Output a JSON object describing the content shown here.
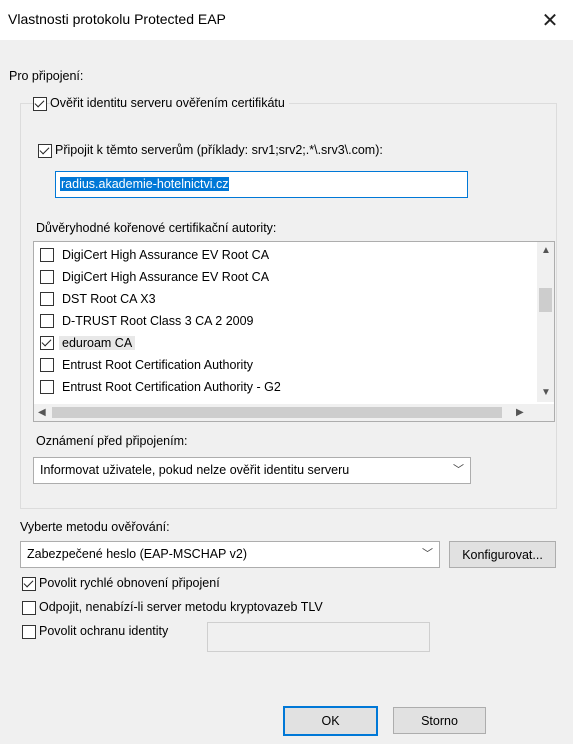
{
  "window": {
    "title": "Vlastnosti protokolu Protected EAP",
    "close_glyph": "✕"
  },
  "connection": {
    "label": "Pro připojení:",
    "verify_server_label": "Ověřit identitu serveru ověřením certifikátu",
    "verify_server_checked": true,
    "connect_servers_label": "Připojit k těmto serverům (příklady: srv1;srv2;.*\\.srv3\\.com):",
    "connect_servers_checked": true,
    "server_value": "radius.akademie-hotelnictvi.cz",
    "trusted_ca_label": "Důvěryhodné kořenové certifikační autority:",
    "ca_list": [
      {
        "name": "DigiCert High Assurance EV Root CA",
        "checked": false
      },
      {
        "name": "DigiCert High Assurance EV Root CA",
        "checked": false
      },
      {
        "name": "DST Root CA X3",
        "checked": false
      },
      {
        "name": "D-TRUST Root Class 3 CA 2 2009",
        "checked": false
      },
      {
        "name": "eduroam CA",
        "checked": true
      },
      {
        "name": "Entrust Root Certification Authority",
        "checked": false
      },
      {
        "name": "Entrust Root Certification Authority - G2",
        "checked": false
      }
    ],
    "notification_label": "Oznámení před připojením:",
    "notification_value": "Informovat uživatele, pokud nelze ověřit identitu serveru"
  },
  "auth": {
    "method_label": "Vyberte metodu ověřování:",
    "method_value": "Zabezpečené heslo (EAP-MSCHAP v2)",
    "configure_label": "Konfigurovat...",
    "fast_reconnect_label": "Povolit rychlé obnovení připojení",
    "fast_reconnect_checked": true,
    "disconnect_tlv_label": "Odpojit, nenabízí-li server metodu kryptovazeb TLV",
    "disconnect_tlv_checked": false,
    "identity_privacy_label": "Povolit ochranu identity",
    "identity_privacy_checked": false
  },
  "buttons": {
    "ok": "OK",
    "cancel": "Storno"
  }
}
